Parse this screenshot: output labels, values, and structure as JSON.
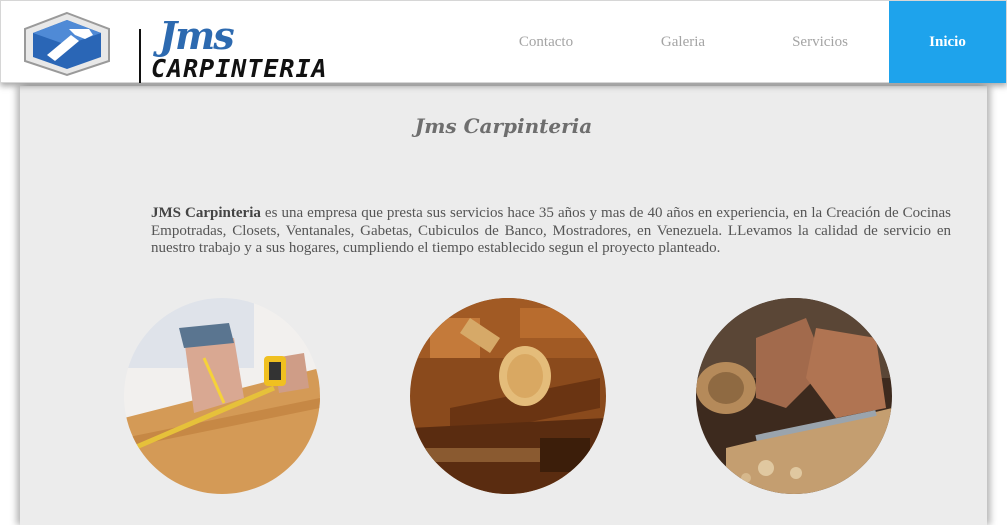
{
  "header": {
    "logo": {
      "script_text": "Jms",
      "text": "CARPINTERIA",
      "icon": "hammer-hexagon-icon",
      "brand_color": "#2d6ab0"
    },
    "nav": [
      {
        "label": "Contacto",
        "active": false
      },
      {
        "label": "Galeria",
        "active": false
      },
      {
        "label": "Servicios",
        "active": false
      },
      {
        "label": "Inicio",
        "active": true
      }
    ],
    "active_color": "#1ea3ec"
  },
  "main": {
    "title": "Jms Carpinteria",
    "intro": {
      "brand": "JMS Carpinteria",
      "text": " es una empresa que presta sus servicios hace 35 años y mas de 40 años en experiencia, en la Creación de Cocinas Empotradas, Closets, Ventanales, Gabetas, Cubiculos de Banco, Mostradores, en Venezuela. LLevamos la calidad de servicio en nuestro trabajo y a sus hogares, cumpliendo el tiempo establecido segun el proyecto planteado."
    },
    "images": [
      {
        "subject": "carpenter-measuring-photo"
      },
      {
        "subject": "woodworking-tools-photo"
      },
      {
        "subject": "wood-planing-photo"
      }
    ]
  }
}
